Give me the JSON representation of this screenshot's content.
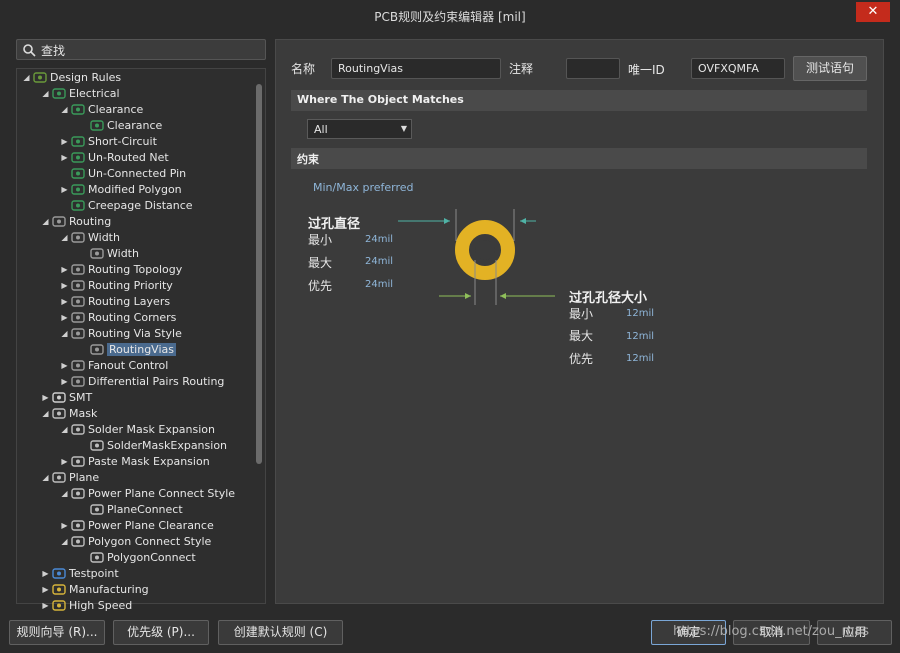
{
  "window": {
    "title": "PCB规则及约束编辑器 [mil]",
    "close_glyph": "✕"
  },
  "search": {
    "label": "查找"
  },
  "tree": [
    {
      "label": "Design Rules",
      "depth": 0,
      "arrow": "◢",
      "icon": "design-rules-icon"
    },
    {
      "label": "Electrical",
      "depth": 1,
      "arrow": "◢",
      "icon": "electrical-icon"
    },
    {
      "label": "Clearance",
      "depth": 2,
      "arrow": "◢",
      "icon": "clearance-icon"
    },
    {
      "label": "Clearance",
      "depth": 3,
      "arrow": "",
      "icon": "clearance-icon"
    },
    {
      "label": "Short-Circuit",
      "depth": 2,
      "arrow": "▶",
      "icon": "short-circuit-icon"
    },
    {
      "label": "Un-Routed Net",
      "depth": 2,
      "arrow": "▶",
      "icon": "unrouted-net-icon"
    },
    {
      "label": "Un-Connected Pin",
      "depth": 2,
      "arrow": "",
      "icon": "unconnected-pin-icon"
    },
    {
      "label": "Modified Polygon",
      "depth": 2,
      "arrow": "▶",
      "icon": "modified-polygon-icon"
    },
    {
      "label": "Creepage Distance",
      "depth": 2,
      "arrow": "",
      "icon": "creepage-icon"
    },
    {
      "label": "Routing",
      "depth": 1,
      "arrow": "◢",
      "icon": "routing-icon"
    },
    {
      "label": "Width",
      "depth": 2,
      "arrow": "◢",
      "icon": "routing-icon"
    },
    {
      "label": "Width",
      "depth": 3,
      "arrow": "",
      "icon": "routing-icon"
    },
    {
      "label": "Routing Topology",
      "depth": 2,
      "arrow": "▶",
      "icon": "routing-icon"
    },
    {
      "label": "Routing Priority",
      "depth": 2,
      "arrow": "▶",
      "icon": "routing-icon"
    },
    {
      "label": "Routing Layers",
      "depth": 2,
      "arrow": "▶",
      "icon": "routing-icon"
    },
    {
      "label": "Routing Corners",
      "depth": 2,
      "arrow": "▶",
      "icon": "routing-icon"
    },
    {
      "label": "Routing Via Style",
      "depth": 2,
      "arrow": "◢",
      "icon": "routing-icon"
    },
    {
      "label": "RoutingVias",
      "depth": 3,
      "arrow": "",
      "icon": "routing-icon",
      "selected": true
    },
    {
      "label": "Fanout Control",
      "depth": 2,
      "arrow": "▶",
      "icon": "routing-icon"
    },
    {
      "label": "Differential Pairs Routing",
      "depth": 2,
      "arrow": "▶",
      "icon": "routing-icon"
    },
    {
      "label": "SMT",
      "depth": 1,
      "arrow": "▶",
      "icon": "smt-icon"
    },
    {
      "label": "Mask",
      "depth": 1,
      "arrow": "◢",
      "icon": "mask-icon"
    },
    {
      "label": "Solder Mask Expansion",
      "depth": 2,
      "arrow": "◢",
      "icon": "mask-icon"
    },
    {
      "label": "SolderMaskExpansion",
      "depth": 3,
      "arrow": "",
      "icon": "mask-icon"
    },
    {
      "label": "Paste Mask Expansion",
      "depth": 2,
      "arrow": "▶",
      "icon": "mask-icon"
    },
    {
      "label": "Plane",
      "depth": 1,
      "arrow": "◢",
      "icon": "plane-icon"
    },
    {
      "label": "Power Plane Connect Style",
      "depth": 2,
      "arrow": "◢",
      "icon": "plane-icon"
    },
    {
      "label": "PlaneConnect",
      "depth": 3,
      "arrow": "",
      "icon": "plane-icon"
    },
    {
      "label": "Power Plane Clearance",
      "depth": 2,
      "arrow": "▶",
      "icon": "plane-icon"
    },
    {
      "label": "Polygon Connect Style",
      "depth": 2,
      "arrow": "◢",
      "icon": "plane-icon"
    },
    {
      "label": "PolygonConnect",
      "depth": 3,
      "arrow": "",
      "icon": "plane-icon"
    },
    {
      "label": "Testpoint",
      "depth": 1,
      "arrow": "▶",
      "icon": "testpoint-icon"
    },
    {
      "label": "Manufacturing",
      "depth": 1,
      "arrow": "▶",
      "icon": "manufacturing-icon"
    },
    {
      "label": "High Speed",
      "depth": 1,
      "arrow": "▶",
      "icon": "high-speed-icon"
    }
  ],
  "rule": {
    "name_label": "名称",
    "name_value": "RoutingVias",
    "comment_label": "注释",
    "comment_value": "",
    "uid_label": "唯一ID",
    "uid_value": "OVFXQMFA",
    "test_button": "测试语句"
  },
  "where": {
    "header": "Where The Object Matches",
    "selected": "All"
  },
  "constraints": {
    "header": "约束",
    "mode": "Min/Max preferred",
    "diameter": {
      "title": "过孔直径",
      "rows": [
        {
          "label": "最小",
          "value": "24mil"
        },
        {
          "label": "最大",
          "value": "24mil"
        },
        {
          "label": "优先",
          "value": "24mil"
        }
      ]
    },
    "hole": {
      "title": "过孔孔径大小",
      "rows": [
        {
          "label": "最小",
          "value": "12mil"
        },
        {
          "label": "最大",
          "value": "12mil"
        },
        {
          "label": "优先",
          "value": "12mil"
        }
      ]
    }
  },
  "buttons": {
    "wizard": "规则向导 (R)...",
    "priority": "优先级 (P)...",
    "defaults": "创建默认规则 (C)",
    "ok": "确定",
    "cancel": "取消",
    "apply": "应用"
  },
  "watermark": "https://blog.csdn.net/zou_mas",
  "colors": {
    "via_ring": "#e3b224",
    "selection": "#4f6b8a",
    "accent_text": "#8fb6d9"
  }
}
